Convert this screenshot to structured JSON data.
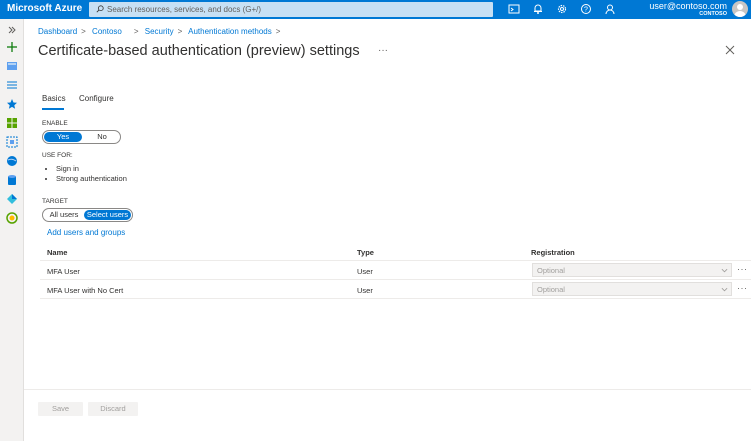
{
  "topbar": {
    "brand": "Microsoft Azure",
    "search_placeholder": "Search resources, services, and docs (G+/)",
    "user_email": "user@contoso.com",
    "user_tenant": "CONTOSO",
    "icons": [
      "cloud-shell-icon",
      "notifications-icon",
      "settings-icon",
      "help-icon",
      "feedback-icon"
    ]
  },
  "sidebar": {
    "icons": [
      "expand-icon",
      "create-resource-icon",
      "home-icon",
      "all-services-icon",
      "favorites-icon",
      "dashboard-grid-icon",
      "resource-groups-icon",
      "app-services-icon",
      "sql-database-icon",
      "cloud-icon",
      "monitor-icon"
    ]
  },
  "breadcrumb": {
    "items": [
      "Dashboard",
      "Contoso",
      "Security",
      "Authentication methods"
    ]
  },
  "page": {
    "title": "Certificate-based authentication (preview) settings",
    "more": "···"
  },
  "tabs": [
    "Basics",
    "Configure"
  ],
  "enable": {
    "label": "ENABLE",
    "options": [
      "Yes",
      "No"
    ],
    "selected": "Yes"
  },
  "use_for": {
    "label": "USE FOR:",
    "items": [
      "Sign in",
      "Strong authentication"
    ]
  },
  "target": {
    "label": "TARGET",
    "options": [
      "All users",
      "Select users"
    ],
    "selected": "Select users",
    "add_link": "Add users and groups"
  },
  "table": {
    "columns": [
      "Name",
      "Type",
      "Registration"
    ],
    "rows": [
      {
        "name": "MFA User",
        "type": "User",
        "registration": "Optional"
      },
      {
        "name": "MFA User with No Cert",
        "type": "User",
        "registration": "Optional"
      }
    ]
  },
  "footer": {
    "save": "Save",
    "discard": "Discard"
  },
  "colors": {
    "accent": "#0078d4",
    "topbar": "#0078d4"
  }
}
